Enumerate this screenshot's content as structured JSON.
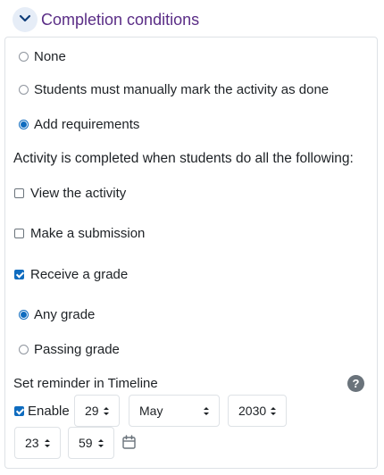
{
  "header": {
    "title": "Completion conditions"
  },
  "options": {
    "none": "None",
    "manual": "Students must manually mark the activity as done",
    "add": "Add requirements"
  },
  "instruction": "Activity is completed when students do all the following:",
  "conditions": {
    "view": "View the activity",
    "submission": "Make a submission",
    "grade": "Receive a grade"
  },
  "grade_options": {
    "any": "Any grade",
    "passing": "Passing grade"
  },
  "reminder": {
    "label": "Set reminder in Timeline",
    "help": "?",
    "enable": "Enable",
    "day": "29",
    "month": "May",
    "year": "2030",
    "hour": "23",
    "minute": "59"
  }
}
